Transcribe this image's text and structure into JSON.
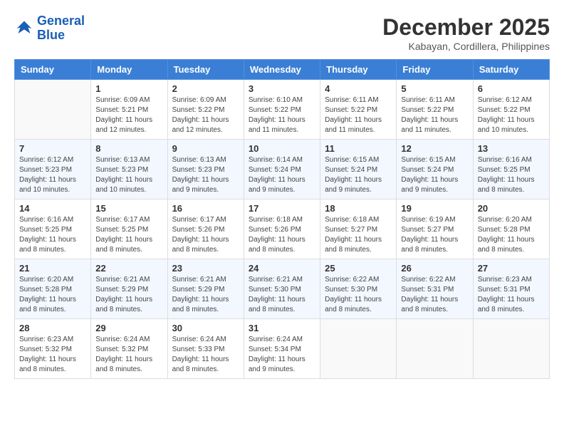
{
  "logo": {
    "line1": "General",
    "line2": "Blue"
  },
  "title": "December 2025",
  "subtitle": "Kabayan, Cordillera, Philippines",
  "weekdays": [
    "Sunday",
    "Monday",
    "Tuesday",
    "Wednesday",
    "Thursday",
    "Friday",
    "Saturday"
  ],
  "weeks": [
    [
      {
        "day": "",
        "info": ""
      },
      {
        "day": "1",
        "info": "Sunrise: 6:09 AM\nSunset: 5:21 PM\nDaylight: 11 hours\nand 12 minutes."
      },
      {
        "day": "2",
        "info": "Sunrise: 6:09 AM\nSunset: 5:22 PM\nDaylight: 11 hours\nand 12 minutes."
      },
      {
        "day": "3",
        "info": "Sunrise: 6:10 AM\nSunset: 5:22 PM\nDaylight: 11 hours\nand 11 minutes."
      },
      {
        "day": "4",
        "info": "Sunrise: 6:11 AM\nSunset: 5:22 PM\nDaylight: 11 hours\nand 11 minutes."
      },
      {
        "day": "5",
        "info": "Sunrise: 6:11 AM\nSunset: 5:22 PM\nDaylight: 11 hours\nand 11 minutes."
      },
      {
        "day": "6",
        "info": "Sunrise: 6:12 AM\nSunset: 5:22 PM\nDaylight: 11 hours\nand 10 minutes."
      }
    ],
    [
      {
        "day": "7",
        "info": "Sunrise: 6:12 AM\nSunset: 5:23 PM\nDaylight: 11 hours\nand 10 minutes."
      },
      {
        "day": "8",
        "info": "Sunrise: 6:13 AM\nSunset: 5:23 PM\nDaylight: 11 hours\nand 10 minutes."
      },
      {
        "day": "9",
        "info": "Sunrise: 6:13 AM\nSunset: 5:23 PM\nDaylight: 11 hours\nand 9 minutes."
      },
      {
        "day": "10",
        "info": "Sunrise: 6:14 AM\nSunset: 5:24 PM\nDaylight: 11 hours\nand 9 minutes."
      },
      {
        "day": "11",
        "info": "Sunrise: 6:15 AM\nSunset: 5:24 PM\nDaylight: 11 hours\nand 9 minutes."
      },
      {
        "day": "12",
        "info": "Sunrise: 6:15 AM\nSunset: 5:24 PM\nDaylight: 11 hours\nand 9 minutes."
      },
      {
        "day": "13",
        "info": "Sunrise: 6:16 AM\nSunset: 5:25 PM\nDaylight: 11 hours\nand 8 minutes."
      }
    ],
    [
      {
        "day": "14",
        "info": "Sunrise: 6:16 AM\nSunset: 5:25 PM\nDaylight: 11 hours\nand 8 minutes."
      },
      {
        "day": "15",
        "info": "Sunrise: 6:17 AM\nSunset: 5:25 PM\nDaylight: 11 hours\nand 8 minutes."
      },
      {
        "day": "16",
        "info": "Sunrise: 6:17 AM\nSunset: 5:26 PM\nDaylight: 11 hours\nand 8 minutes."
      },
      {
        "day": "17",
        "info": "Sunrise: 6:18 AM\nSunset: 5:26 PM\nDaylight: 11 hours\nand 8 minutes."
      },
      {
        "day": "18",
        "info": "Sunrise: 6:18 AM\nSunset: 5:27 PM\nDaylight: 11 hours\nand 8 minutes."
      },
      {
        "day": "19",
        "info": "Sunrise: 6:19 AM\nSunset: 5:27 PM\nDaylight: 11 hours\nand 8 minutes."
      },
      {
        "day": "20",
        "info": "Sunrise: 6:20 AM\nSunset: 5:28 PM\nDaylight: 11 hours\nand 8 minutes."
      }
    ],
    [
      {
        "day": "21",
        "info": "Sunrise: 6:20 AM\nSunset: 5:28 PM\nDaylight: 11 hours\nand 8 minutes."
      },
      {
        "day": "22",
        "info": "Sunrise: 6:21 AM\nSunset: 5:29 PM\nDaylight: 11 hours\nand 8 minutes."
      },
      {
        "day": "23",
        "info": "Sunrise: 6:21 AM\nSunset: 5:29 PM\nDaylight: 11 hours\nand 8 minutes."
      },
      {
        "day": "24",
        "info": "Sunrise: 6:21 AM\nSunset: 5:30 PM\nDaylight: 11 hours\nand 8 minutes."
      },
      {
        "day": "25",
        "info": "Sunrise: 6:22 AM\nSunset: 5:30 PM\nDaylight: 11 hours\nand 8 minutes."
      },
      {
        "day": "26",
        "info": "Sunrise: 6:22 AM\nSunset: 5:31 PM\nDaylight: 11 hours\nand 8 minutes."
      },
      {
        "day": "27",
        "info": "Sunrise: 6:23 AM\nSunset: 5:31 PM\nDaylight: 11 hours\nand 8 minutes."
      }
    ],
    [
      {
        "day": "28",
        "info": "Sunrise: 6:23 AM\nSunset: 5:32 PM\nDaylight: 11 hours\nand 8 minutes."
      },
      {
        "day": "29",
        "info": "Sunrise: 6:24 AM\nSunset: 5:32 PM\nDaylight: 11 hours\nand 8 minutes."
      },
      {
        "day": "30",
        "info": "Sunrise: 6:24 AM\nSunset: 5:33 PM\nDaylight: 11 hours\nand 8 minutes."
      },
      {
        "day": "31",
        "info": "Sunrise: 6:24 AM\nSunset: 5:34 PM\nDaylight: 11 hours\nand 9 minutes."
      },
      {
        "day": "",
        "info": ""
      },
      {
        "day": "",
        "info": ""
      },
      {
        "day": "",
        "info": ""
      }
    ]
  ]
}
